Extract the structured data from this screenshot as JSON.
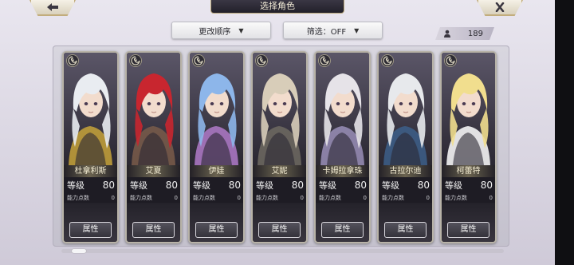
{
  "header": {
    "title": "选择角色",
    "back_icon": "back-arrow-icon",
    "close_icon": "close-icon"
  },
  "toolbar": {
    "sort_label": "更改顺序",
    "filter_label": "筛选：OFF",
    "caret": "▼",
    "owned_count": "189",
    "owned_icon": "person-icon"
  },
  "characters": [
    {
      "name": "杜拿利斯",
      "level_label": "等级",
      "level": "80",
      "points_label": "能力点数",
      "points": "0",
      "button": "属性",
      "hair": "#e9ecf1",
      "accent": "#c7a33a"
    },
    {
      "name": "艾夏",
      "level_label": "等级",
      "level": "80",
      "points_label": "能力点数",
      "points": "0",
      "button": "属性",
      "hair": "#c8262f",
      "accent": "#7a5c4a"
    },
    {
      "name": "伊娃",
      "level_label": "等级",
      "level": "80",
      "points_label": "能力点数",
      "points": "0",
      "button": "属性",
      "hair": "#8db6ea",
      "accent": "#b07ac9"
    },
    {
      "name": "艾妮",
      "level_label": "等级",
      "level": "80",
      "points_label": "能力点数",
      "points": "0",
      "button": "属性",
      "hair": "#d8cdb9",
      "accent": "#6f6a62"
    },
    {
      "name": "卡姆拉拿珠",
      "level_label": "等级",
      "level": "80",
      "points_label": "能力点数",
      "points": "0",
      "button": "属性",
      "hair": "#e6e3e8",
      "accent": "#9a8fb8"
    },
    {
      "name": "古拉尔迪",
      "level_label": "等级",
      "level": "80",
      "points_label": "能力点数",
      "points": "0",
      "button": "属性",
      "hair": "#e7e9ec",
      "accent": "#3d5f8a"
    },
    {
      "name": "柯蕾特",
      "level_label": "等级",
      "level": "80",
      "points_label": "能力点数",
      "points": "0",
      "button": "属性",
      "hair": "#f1de8e",
      "accent": "#ffffff"
    }
  ],
  "colors": {
    "card_bg": "#1e1c24",
    "name_text": "#f3ecd2",
    "plate_border": "#c2ad7c"
  }
}
